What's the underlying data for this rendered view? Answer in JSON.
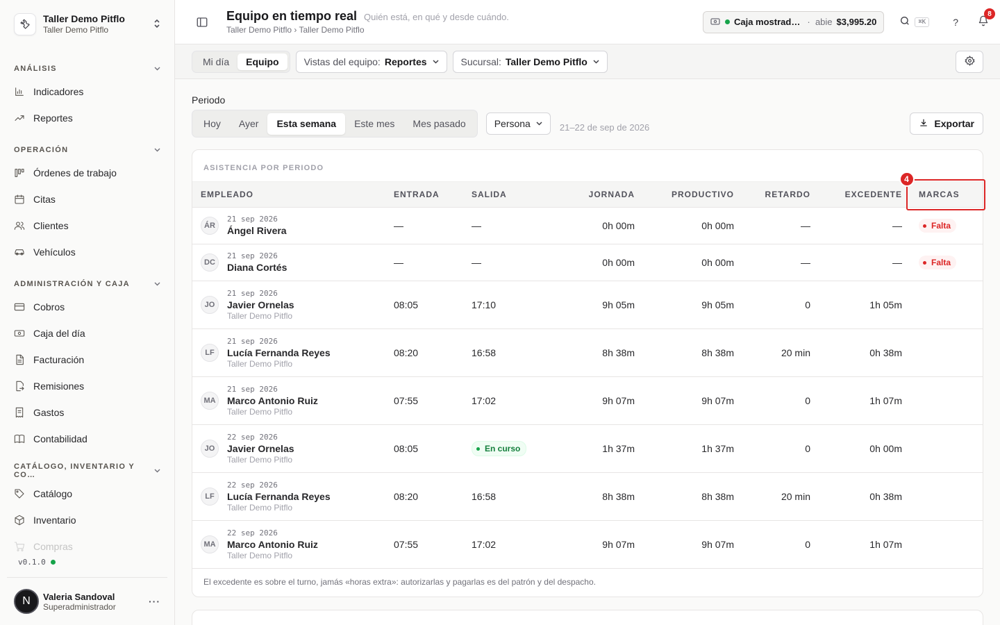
{
  "org": {
    "name": "Taller Demo Pitflo",
    "sub": "Taller Demo Pitflo"
  },
  "sidebar": {
    "sections": [
      {
        "title": "ANÁLISIS",
        "items": [
          {
            "label": "Indicadores",
            "icon": "bar-chart-icon"
          },
          {
            "label": "Reportes",
            "icon": "trending-icon"
          }
        ]
      },
      {
        "title": "OPERACIÓN",
        "items": [
          {
            "label": "Órdenes de trabajo",
            "icon": "kanban-icon"
          },
          {
            "label": "Citas",
            "icon": "calendar-icon"
          },
          {
            "label": "Clientes",
            "icon": "users-icon"
          },
          {
            "label": "Vehículos",
            "icon": "car-icon"
          }
        ]
      },
      {
        "title": "ADMINISTRACIÓN Y CAJA",
        "items": [
          {
            "label": "Cobros",
            "icon": "card-icon"
          },
          {
            "label": "Caja del día",
            "icon": "cash-icon"
          },
          {
            "label": "Facturación",
            "icon": "file-icon"
          },
          {
            "label": "Remisiones",
            "icon": "file-export-icon"
          },
          {
            "label": "Gastos",
            "icon": "receipt-icon"
          },
          {
            "label": "Contabilidad",
            "icon": "book-icon"
          }
        ]
      },
      {
        "title": "CATÁLOGO, INVENTARIO Y CO…",
        "items": [
          {
            "label": "Catálogo",
            "icon": "tag-icon"
          },
          {
            "label": "Inventario",
            "icon": "box-icon"
          },
          {
            "label": "Compras",
            "icon": "cart-icon"
          }
        ]
      }
    ],
    "version": "v0.1.0",
    "user": {
      "initial": "N",
      "name": "Valeria Sandoval",
      "role": "Superadministrador"
    }
  },
  "header": {
    "title": "Equipo en tiempo real",
    "subtitle": "Quién está, en qué y desde cuándo.",
    "breadcrumb": "Taller Demo Pitflo › Taller Demo Pitflo",
    "cash": {
      "name": "Caja mostrad…",
      "sep": "·",
      "state": "abie",
      "amount": "$3,995.20"
    },
    "search_kbd": "⌘K",
    "help": "?",
    "notif_count": "8"
  },
  "toolbar": {
    "tabs": [
      "Mi día",
      "Equipo"
    ],
    "views_label": "Vistas del equipo:",
    "views_value": "Reportes",
    "branch_label": "Sucursal:",
    "branch_value": "Taller Demo Pitflo"
  },
  "period": {
    "label": "Periodo",
    "options": [
      "Hoy",
      "Ayer",
      "Esta semana",
      "Este mes",
      "Mes pasado"
    ],
    "group_by": "Persona",
    "range": "21–22 de sep de 2026",
    "export_label": "Exportar"
  },
  "table": {
    "title": "ASISTENCIA POR PERIODO",
    "columns": [
      "EMPLEADO",
      "ENTRADA",
      "SALIDA",
      "JORNADA",
      "PRODUCTIVO",
      "RETARDO",
      "EXCEDENTE",
      "MARCAS"
    ],
    "highlight_number": "4",
    "rows": [
      {
        "ini": "ÁR",
        "date": "21 sep 2026",
        "name": "Ángel Rivera",
        "branch": "",
        "entrada": "—",
        "salida": "—",
        "jornada": "0h 00m",
        "productivo": "0h 00m",
        "retardo": "—",
        "excedente": "—",
        "marcas": "Falta"
      },
      {
        "ini": "DC",
        "date": "21 sep 2026",
        "name": "Diana Cortés",
        "branch": "",
        "entrada": "—",
        "salida": "—",
        "jornada": "0h 00m",
        "productivo": "0h 00m",
        "retardo": "—",
        "excedente": "—",
        "marcas": "Falta"
      },
      {
        "ini": "JO",
        "date": "21 sep 2026",
        "name": "Javier Ornelas",
        "branch": "Taller Demo Pitflo",
        "entrada": "08:05",
        "salida": "17:10",
        "jornada": "9h 05m",
        "productivo": "9h 05m",
        "retardo": "0",
        "excedente": "1h 05m",
        "marcas": ""
      },
      {
        "ini": "LF",
        "date": "21 sep 2026",
        "name": "Lucía Fernanda Reyes",
        "branch": "Taller Demo Pitflo",
        "entrada": "08:20",
        "salida": "16:58",
        "jornada": "8h 38m",
        "productivo": "8h 38m",
        "retardo": "20 min",
        "excedente": "0h 38m",
        "marcas": ""
      },
      {
        "ini": "MA",
        "date": "21 sep 2026",
        "name": "Marco Antonio Ruiz",
        "branch": "Taller Demo Pitflo",
        "entrada": "07:55",
        "salida": "17:02",
        "jornada": "9h 07m",
        "productivo": "9h 07m",
        "retardo": "0",
        "excedente": "1h 07m",
        "marcas": ""
      },
      {
        "ini": "JO",
        "date": "22 sep 2026",
        "name": "Javier Ornelas",
        "branch": "Taller Demo Pitflo",
        "entrada": "08:05",
        "salida": "En curso",
        "jornada": "1h 37m",
        "productivo": "1h 37m",
        "retardo": "0",
        "excedente": "0h 00m",
        "marcas": ""
      },
      {
        "ini": "LF",
        "date": "22 sep 2026",
        "name": "Lucía Fernanda Reyes",
        "branch": "Taller Demo Pitflo",
        "entrada": "08:20",
        "salida": "16:58",
        "jornada": "8h 38m",
        "productivo": "8h 38m",
        "retardo": "20 min",
        "excedente": "0h 38m",
        "marcas": ""
      },
      {
        "ini": "MA",
        "date": "22 sep 2026",
        "name": "Marco Antonio Ruiz",
        "branch": "Taller Demo Pitflo",
        "entrada": "07:55",
        "salida": "17:02",
        "jornada": "9h 07m",
        "productivo": "9h 07m",
        "retardo": "0",
        "excedente": "1h 07m",
        "marcas": ""
      }
    ],
    "footnote": "El excedente es sobre el turno, jamás «horas extra»: autorizarlas y pagarlas es del patrón y del despacho."
  }
}
